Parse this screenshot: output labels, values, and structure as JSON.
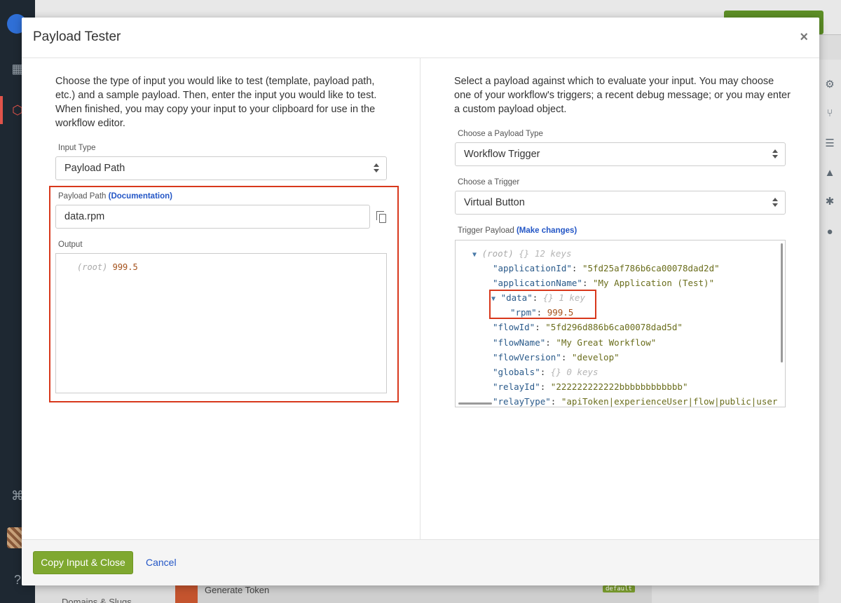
{
  "background": {
    "generate_token": "Generate Token",
    "domains": "Domains & Slugs",
    "default_tag": "default"
  },
  "modal": {
    "title": "Payload Tester",
    "close_glyph": "×",
    "left": {
      "intro": "Choose the type of input you would like to test (template, payload path, etc.) and a sample payload. Then, enter the input you would like to test. When finished, you may copy your input to your clipboard for use in the workflow editor.",
      "input_type_label": "Input Type",
      "input_type_value": "Payload Path",
      "payload_path_label": "Payload Path",
      "payload_path_link": "(Documentation)",
      "payload_path_value": "data.rpm",
      "output_label": "Output",
      "output_root": "(root)",
      "output_value": "999.5"
    },
    "right": {
      "intro": "Select a payload against which to evaluate your input. You may choose one of your workflow's triggers; a recent debug message; or you may enter a custom payload object.",
      "payload_type_label": "Choose a Payload Type",
      "payload_type_value": "Workflow Trigger",
      "trigger_label": "Choose a Trigger",
      "trigger_value": "Virtual Button",
      "trigger_payload_label": "Trigger Payload",
      "trigger_payload_link": "(Make changes)",
      "json": {
        "root": "(root)",
        "root_meta": "{}  12 keys",
        "applicationId_key": "\"applicationId\"",
        "applicationId_val": "\"5fd25af786b6ca00078dad2d\"",
        "applicationName_key": "\"applicationName\"",
        "applicationName_val": "\"My Application (Test)\"",
        "data_key": "\"data\"",
        "data_meta": "{}  1 key",
        "rpm_key": "\"rpm\"",
        "rpm_val": "999.5",
        "flowId_key": "\"flowId\"",
        "flowId_val": "\"5fd296d886b6ca00078dad5d\"",
        "flowName_key": "\"flowName\"",
        "flowName_val": "\"My Great Workflow\"",
        "flowVersion_key": "\"flowVersion\"",
        "flowVersion_val": "\"develop\"",
        "globals_key": "\"globals\"",
        "globals_meta": "{}  0 keys",
        "relayId_key": "\"relayId\"",
        "relayId_val": "\"222222222222bbbbbbbbbbbb\"",
        "relayType_key": "\"relayType\"",
        "relayType_val": "\"apiToken|experienceUser|flow|public|user"
      }
    },
    "footer": {
      "copy_button": "Copy Input & Close",
      "cancel_button": "Cancel"
    }
  },
  "colors": {
    "highlight": "#d8381c",
    "primary_button": "#7fa830",
    "link": "#2356c6"
  }
}
